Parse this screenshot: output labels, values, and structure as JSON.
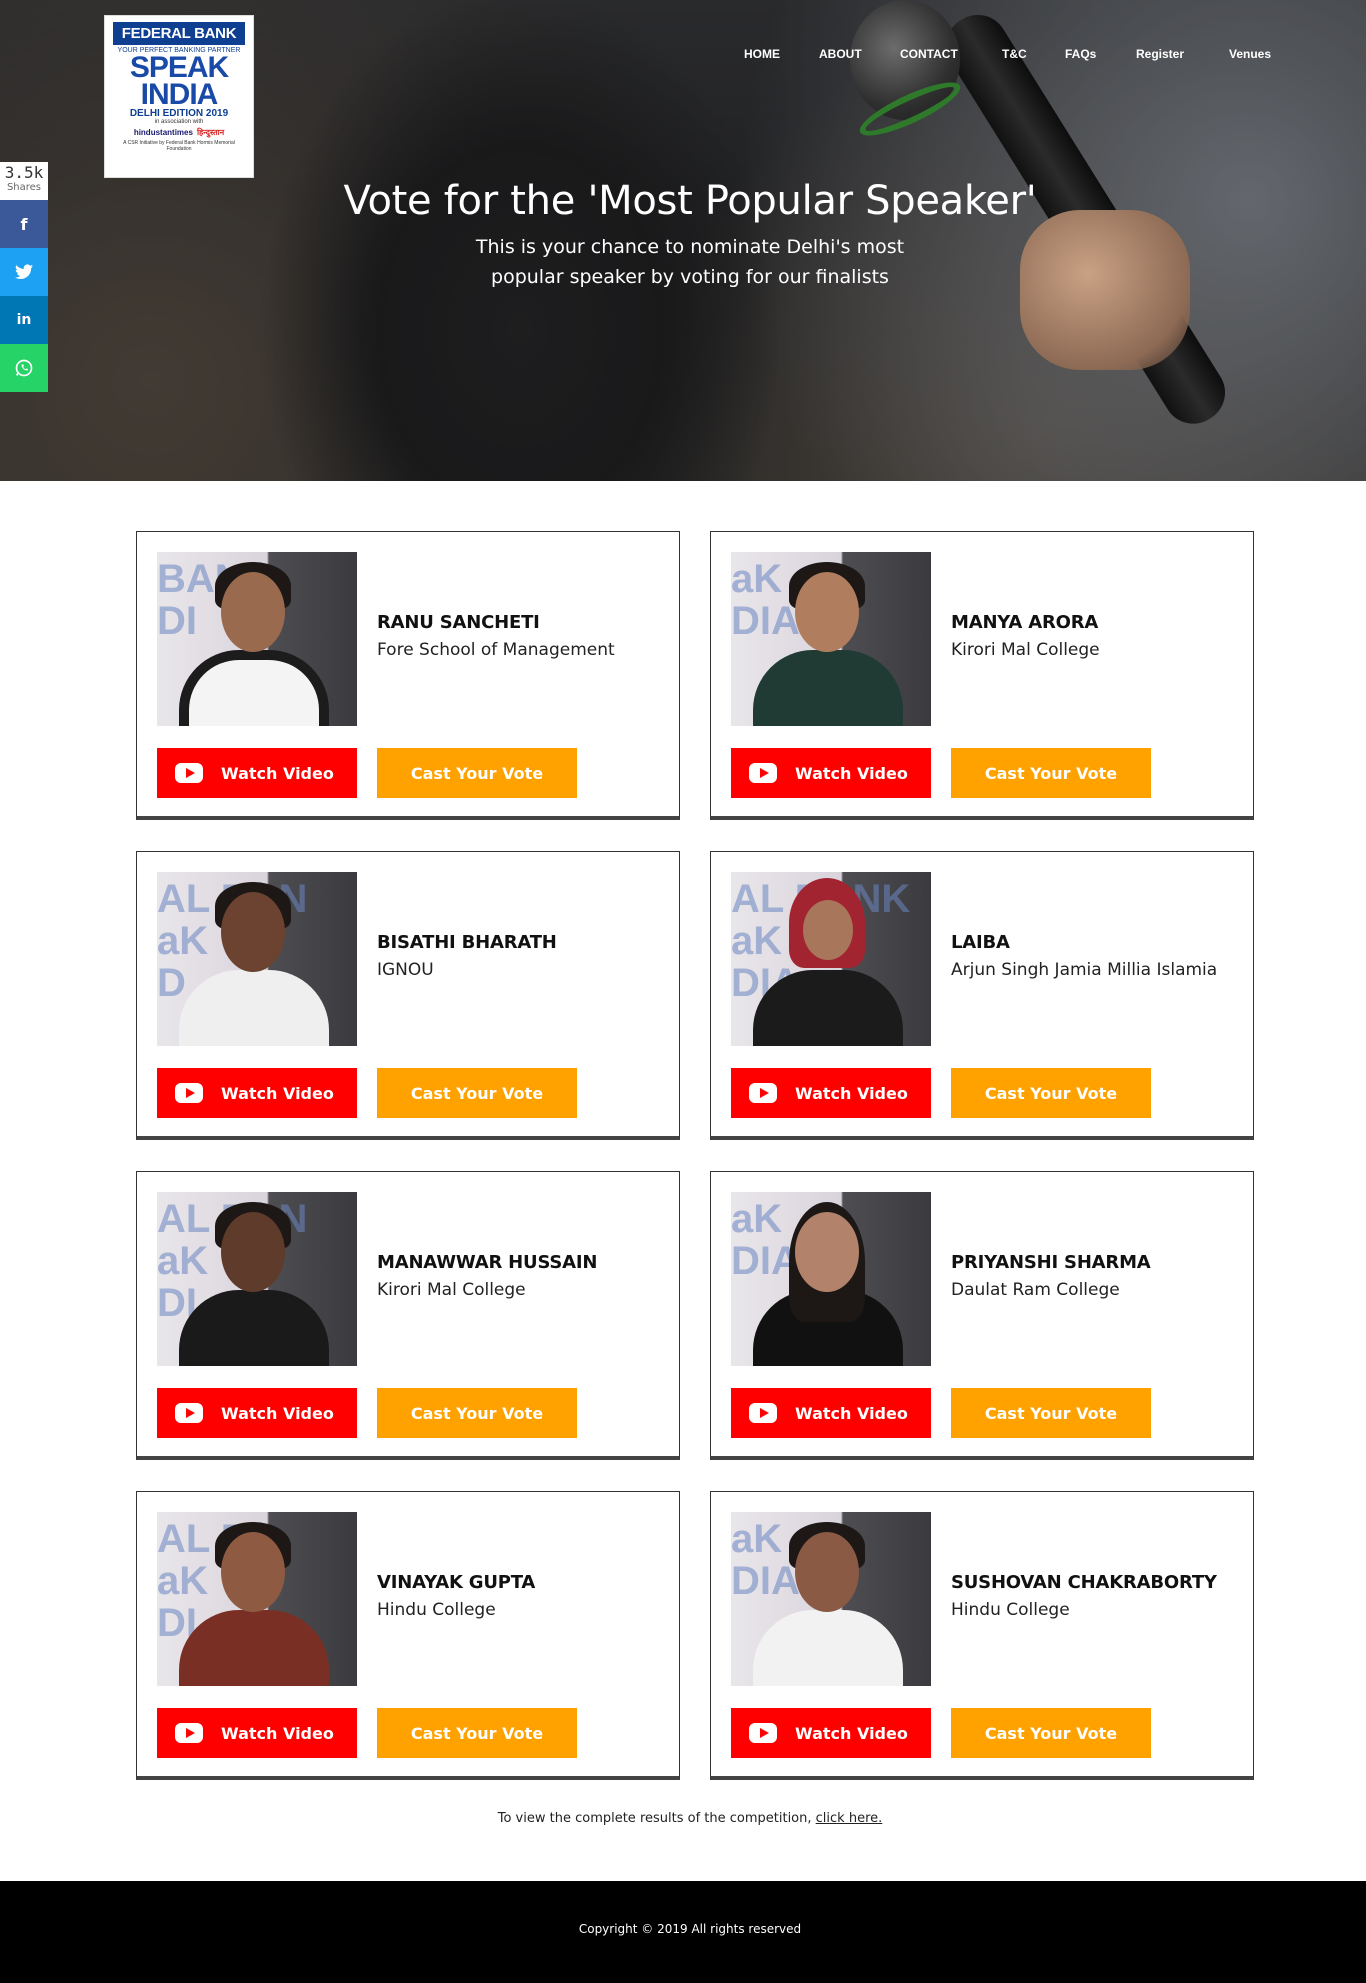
{
  "logo": {
    "bank": "FEDERAL BANK",
    "tagline": "YOUR PERFECT BANKING PARTNER",
    "speak": "SPEAK",
    "for_india": "INDIA",
    "edition": "DELHI EDITION 2019",
    "assoc": "in association with",
    "partner1": "hindustantimes",
    "partner2": "हिन्दुस्तान",
    "csr": "A CSR Initiative by Federal Bank Hormis Memorial Foundation"
  },
  "nav": {
    "items": [
      "HOME",
      "ABOUT",
      "CONTACT",
      "T&C",
      "FAQs",
      "Register",
      "Venues"
    ]
  },
  "hero": {
    "title": "Vote for the 'Most Popular Speaker'",
    "subtitle_line1": "This is your chance to nominate Delhi's most",
    "subtitle_line2": "popular speaker by voting for our finalists"
  },
  "share": {
    "count": "3.5k",
    "label": "Shares",
    "icons": [
      "facebook-icon",
      "twitter-icon",
      "linkedin-icon",
      "whatsapp-icon"
    ]
  },
  "buttons": {
    "watch": "Watch Video",
    "vote": "Cast Your Vote"
  },
  "finalists": [
    {
      "name": "RANU SANCHETI",
      "school": "Fore School of Management"
    },
    {
      "name": "MANYA ARORA",
      "school": "Kirori Mal College"
    },
    {
      "name": "BISATHI BHARATH",
      "school": "IGNOU"
    },
    {
      "name": "LAIBA",
      "school": "Arjun Singh Jamia Millia Islamia"
    },
    {
      "name": "MANAWWAR HUSSAIN",
      "school": "Kirori Mal College"
    },
    {
      "name": "PRIYANSHI SHARMA",
      "school": "Daulat Ram College"
    },
    {
      "name": "VINAYAK GUPTA",
      "school": "Hindu College"
    },
    {
      "name": "SUSHOVAN CHAKRABORTY",
      "school": "Hindu College"
    }
  ],
  "results": {
    "text": "To view the complete results of the competition,",
    "link": "click here."
  },
  "footer": {
    "copyright": "Copyright © 2019 All rights reserved"
  },
  "colors": {
    "watch": "#ff0000",
    "vote": "#ffa200",
    "footer": "#000000"
  }
}
